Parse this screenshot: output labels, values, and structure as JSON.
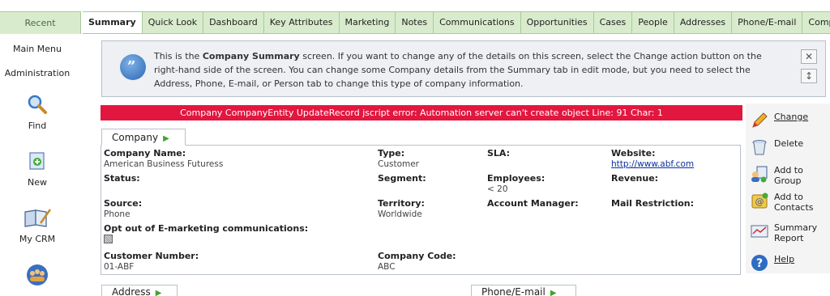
{
  "recent_tab": "Recent",
  "tabs": [
    {
      "label": "Summary",
      "active": true
    },
    {
      "label": "Quick Look"
    },
    {
      "label": "Dashboard"
    },
    {
      "label": "Key Attributes"
    },
    {
      "label": "Marketing"
    },
    {
      "label": "Notes"
    },
    {
      "label": "Communications"
    },
    {
      "label": "Opportunities"
    },
    {
      "label": "Cases"
    },
    {
      "label": "People"
    },
    {
      "label": "Addresses"
    },
    {
      "label": "Phone/E-mail"
    },
    {
      "label": "Company Te"
    }
  ],
  "sidebar": {
    "main_menu": "Main Menu",
    "administration": "Administration",
    "items": [
      {
        "label": "Find",
        "icon": "magnifier-icon"
      },
      {
        "label": "New",
        "icon": "new-document-icon"
      },
      {
        "label": "My CRM",
        "icon": "my-crm-icon"
      },
      {
        "label": "",
        "icon": "team-icon"
      }
    ]
  },
  "info": {
    "text_before": "This is the ",
    "text_bold": "Company Summary",
    "text_after": " screen. If you want to change any of the details on this screen, select the Change action button on the right-hand side of the screen. You can change some Company details from the Summary tab in edit mode, but you need to select the Address, Phone, E-mail, or Person tab to change this type of company information.",
    "close_glyph": "✕",
    "expand_glyph": "↕"
  },
  "error": "Company CompanyEntity UpdateRecord jscript error: Automation server can't create object Line: 91 Char: 1",
  "company_tab": "Company",
  "fields": {
    "company_name": {
      "label": "Company Name:",
      "value": "American Business Futuress"
    },
    "type": {
      "label": "Type:",
      "value": "Customer"
    },
    "sla": {
      "label": "SLA:",
      "value": ""
    },
    "website": {
      "label": "Website:",
      "value": "http://www.abf.com"
    },
    "status": {
      "label": "Status:",
      "value": ""
    },
    "segment": {
      "label": "Segment:",
      "value": ""
    },
    "employees": {
      "label": "Employees:",
      "value": "< 20"
    },
    "revenue": {
      "label": "Revenue:",
      "value": ""
    },
    "source": {
      "label": "Source:",
      "value": "Phone"
    },
    "territory": {
      "label": "Territory:",
      "value": "Worldwide"
    },
    "account_manager": {
      "label": "Account Manager:",
      "value": ""
    },
    "mail_restriction": {
      "label": "Mail Restriction:",
      "value": ""
    },
    "opt_out": {
      "label": "Opt out of E-marketing communications:"
    },
    "customer_number": {
      "label": "Customer Number:",
      "value": "01-ABF"
    },
    "company_code": {
      "label": "Company Code:",
      "value": "ABC"
    }
  },
  "bottom_tabs": {
    "address": "Address",
    "phone_email": "Phone/E-mail"
  },
  "actions": [
    {
      "label": "Change",
      "icon": "pencil-icon"
    },
    {
      "label": "Delete",
      "icon": "trash-icon"
    },
    {
      "label": "Add to Group",
      "icon": "add-to-group-icon"
    },
    {
      "label": "Add to Contacts",
      "icon": "add-contact-icon"
    },
    {
      "label": "Summary Report",
      "icon": "report-icon"
    },
    {
      "label": "Help",
      "icon": "help-icon"
    }
  ],
  "colors": {
    "tab_green": "#d8eccd",
    "error_red": "#e2173f",
    "link_blue": "#0d2ea0"
  }
}
